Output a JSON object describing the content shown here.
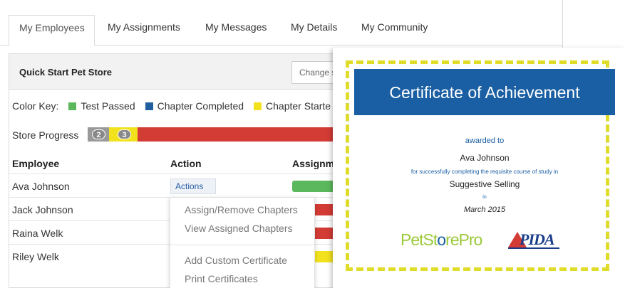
{
  "tabs": [
    {
      "label": "My Employees",
      "active": true
    },
    {
      "label": "My Assignments",
      "active": false
    },
    {
      "label": "My Messages",
      "active": false
    },
    {
      "label": "My Details",
      "active": false
    },
    {
      "label": "My Community",
      "active": false
    }
  ],
  "panel": {
    "store_name": "Quick Start Pet Store",
    "change_store_label": "Change s"
  },
  "color_key": {
    "label": "Color Key:",
    "items": [
      {
        "label": "Test Passed",
        "color": "#5cb85c"
      },
      {
        "label": "Chapter Completed",
        "color": "#1f5fa0"
      },
      {
        "label": "Chapter Starte",
        "color": "#f2e21e"
      }
    ]
  },
  "store_progress": {
    "label": "Store Progress",
    "badges": [
      "2",
      "3"
    ]
  },
  "table": {
    "headers": [
      "Employee",
      "Action",
      "Assignm"
    ],
    "rows": [
      {
        "name": "Ava Johnson",
        "action": "Actions"
      },
      {
        "name": "Jack Johnson"
      },
      {
        "name": "Raina Welk"
      },
      {
        "name": "Riley Welk"
      }
    ]
  },
  "actions_menu": {
    "items": [
      "Assign/Remove Chapters",
      "View Assigned Chapters",
      "Add Custom Certificate",
      "Print Certificates"
    ]
  },
  "certificate": {
    "title": "Certificate of Achievement",
    "awarded_to": "awarded to",
    "recipient": "Ava Johnson",
    "for_line": "for successfully completing the requisite course of study in",
    "course": "Suggestive Selling",
    "in_word": "in",
    "date": "March 2015",
    "logo_petstorepro": "PetStorePro",
    "logo_pida": "PIDA"
  },
  "colors": {
    "brand_blue": "#1a5fa3",
    "progress_red": "#d33b35",
    "passed_green": "#5cb85c",
    "started_yellow": "#f2e21e"
  }
}
